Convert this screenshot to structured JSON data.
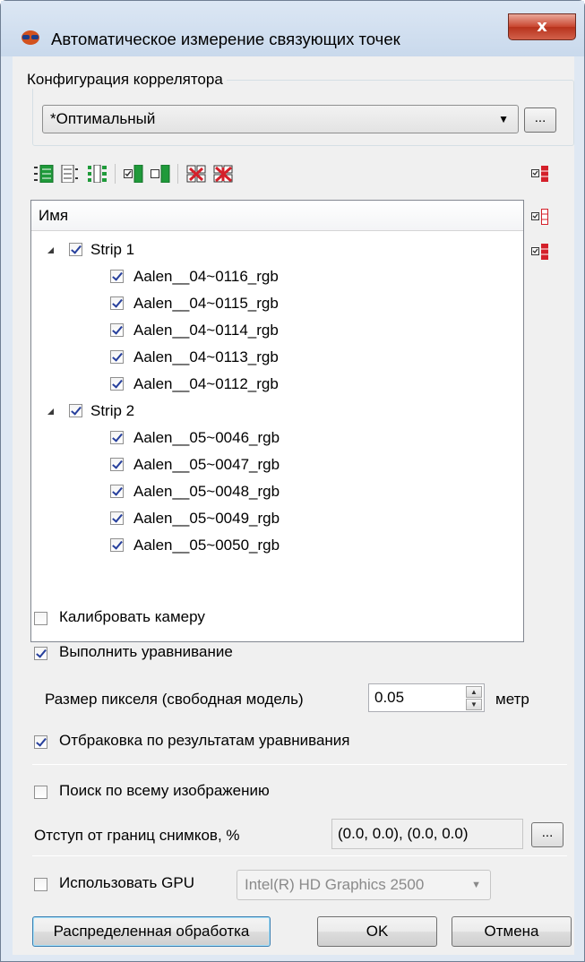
{
  "window": {
    "title": "Автоматическое измерение связующих точек",
    "close_label": "x"
  },
  "correlator": {
    "group_label": "Конфигурация коррелятора",
    "selected": "*Оптимальный",
    "browse_label": "..."
  },
  "tree": {
    "header": "Имя",
    "strips": [
      {
        "label": "Strip 1",
        "checked": true,
        "images": [
          "Aalen__04~0116_rgb",
          "Aalen__04~0115_rgb",
          "Aalen__04~0114_rgb",
          "Aalen__04~0113_rgb",
          "Aalen__04~0112_rgb"
        ]
      },
      {
        "label": "Strip 2",
        "checked": true,
        "images": [
          "Aalen__05~0046_rgb",
          "Aalen__05~0047_rgb",
          "Aalen__05~0048_rgb",
          "Aalen__05~0049_rgb",
          "Aalen__05~0050_rgb"
        ]
      }
    ]
  },
  "options": {
    "calibrate_camera": {
      "label": "Калибровать камеру",
      "checked": false
    },
    "adjustment": {
      "label": "Выполнить уравнивание",
      "checked": true
    },
    "pixel_size": {
      "label": "Размер пикселя (свободная модель)",
      "value": "0.05",
      "unit": "метр"
    },
    "reject": {
      "label": "Отбраковка по результатам уравнивания",
      "checked": true
    },
    "search_whole": {
      "label": "Поиск по всему изображению",
      "checked": false
    },
    "margin": {
      "label": "Отступ от границ снимков, %",
      "value": "(0.0, 0.0), (0.0, 0.0)",
      "browse_label": "..."
    },
    "gpu": {
      "label": "Использовать GPU",
      "checked": false,
      "device": "Intel(R) HD Graphics 2500"
    }
  },
  "buttons": {
    "distributed": "Распределенная обработка",
    "ok": "OK",
    "cancel": "Отмена"
  },
  "colors": {
    "title_bg": "#dce7f4",
    "client_bg": "#f0f0f0",
    "close_red": "#c9452f",
    "checkbox_mark": "#263f9c"
  }
}
